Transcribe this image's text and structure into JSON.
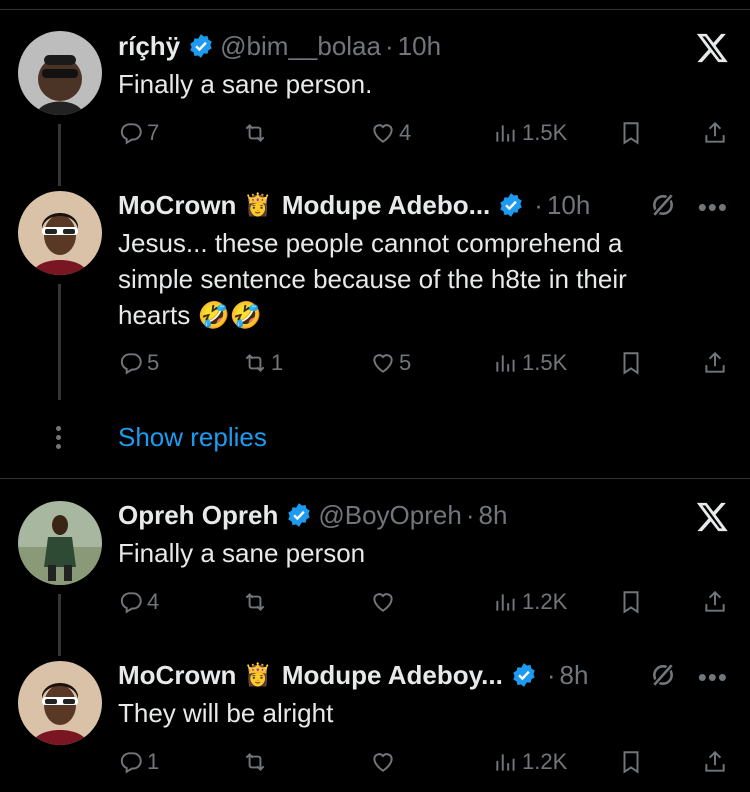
{
  "tweets": [
    {
      "name": "ríçhÿ",
      "handle": "@bim__bolaa",
      "time": "10h",
      "text": "Finally a sane person.",
      "replies": "7",
      "retweets": "",
      "likes": "4",
      "views": "1.5K"
    },
    {
      "name": "MoCrown",
      "crown_emoji": "👸",
      "name2": "Modupe Adebo...",
      "time": "10h",
      "text": "Jesus... these people cannot comprehend a simple sentence because of the h8te in their hearts 🤣🤣",
      "replies": "5",
      "retweets": "1",
      "likes": "5",
      "views": "1.5K"
    },
    {
      "name": "Opreh Opreh",
      "handle": "@BoyOpreh",
      "time": "8h",
      "text": "Finally a sane person",
      "replies": "4",
      "retweets": "",
      "likes": "",
      "views": "1.2K"
    },
    {
      "name": "MoCrown",
      "crown_emoji": "👸",
      "name2": "Modupe Adeboy...",
      "time": "8h",
      "text": "They will be alright",
      "replies": "1",
      "retweets": "",
      "likes": "",
      "views": "1.2K"
    }
  ],
  "show_replies": "Show replies",
  "dot": "·",
  "more": "•••",
  "icons": [
    "reply-icon",
    "retweet-icon",
    "like-icon",
    "views-icon",
    "bookmark-icon",
    "share-icon",
    "x-logo-icon",
    "grok-icon",
    "verified-icon"
  ],
  "colors": {
    "accent": "#1d9bf0",
    "muted": "#71767b",
    "background": "#000000"
  }
}
